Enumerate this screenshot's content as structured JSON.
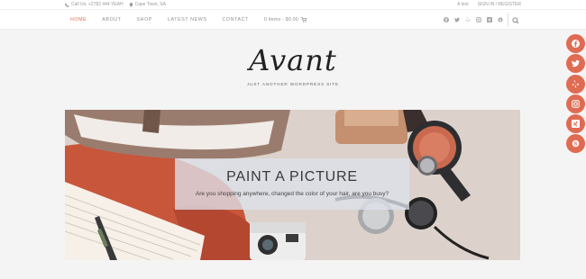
{
  "topbar": {
    "phone": "Call Us: +2782 444 YEAH",
    "location": "Cape Town, SA",
    "text_link": "A text",
    "signin": "SIGN IN / REGISTER"
  },
  "nav": {
    "items": [
      "HOME",
      "ABOUT",
      "SHOP",
      "LATEST NEWS",
      "CONTACT"
    ],
    "cart": "0 items - $0.00"
  },
  "header": {
    "logo": "Avant",
    "tagline": "JUST ANOTHER WORDPRESS SITE"
  },
  "hero": {
    "title": "PAINT A PICTURE",
    "text": "Are you shopping anywhere, changed the color of your hair, are you busy?"
  },
  "share_buttons": [
    "facebook",
    "twitter",
    "yelp",
    "instagram",
    "xing",
    "skype"
  ],
  "colors": {
    "accent": "#e06b53",
    "background": "#f4f4f4"
  }
}
